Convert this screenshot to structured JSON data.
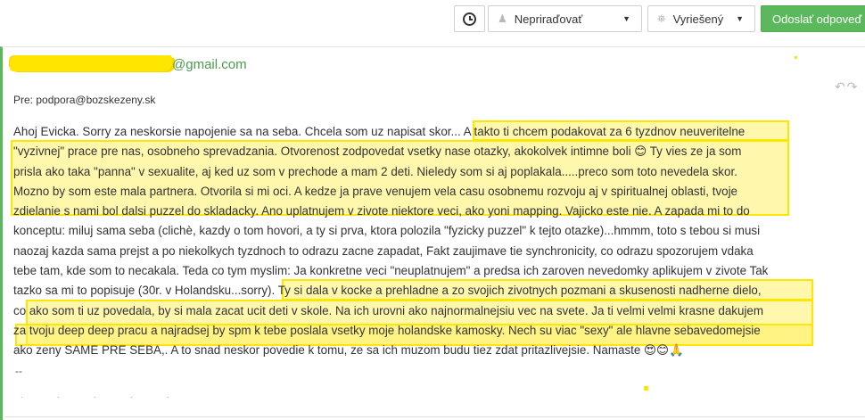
{
  "toolbar": {
    "clock_icon": "clock-icon",
    "assign_label": "Nepriraďovať",
    "status_label": "Vyriešený",
    "send_label": "Odoslať odpoveď"
  },
  "email": {
    "sender_email": "@gmail.com",
    "recipient": "Pre: podpora@bozskezeny.sk",
    "body_lines": [
      "Ahoj Evicka. Sorry za neskorsie napojenie sa na seba. Chcela som uz napisat skor... A takto ti chcem podakovat za 6 tyzdnov neuveritelne",
      "\"vyzivnej\" prace pre nas, osobneho sprevadzania. Otvorenost zodpovedat vsetky nase otazky, akokolvek intimne boli 😊 Ty vies ze ja som",
      "prisla ako taka \"panna\" v sexualite, aj ked uz som v prechode a mam 2 deti. Nieledy som si aj poplakala.....preco som toto nevedela skor.",
      "Mozno by som este mala partnera. Otvorila si mi oci. A kedze ja prave venujem vela casu osobnemu rozvoju aj v spiritualnej oblasti, tvoje",
      "zdielanie s nami bol dalsi puzzel do skladacky. Ano uplatnujem v zivote niektore veci, ako yoni mapping. Vajicko este nie. A zapada mi to do",
      "konceptu: miluj sama seba (clichè, kazdy o tom hovori, a ty si prva, ktora polozila \"fyzicky puzzel\" k tejto otazke)...hmmm, toto s tebou si musi",
      "naozaj kazda sama prejst a po niekolkych tyzdnoch to odrazu zacne zapadat, Fakt zaujimave tie synchronicity, co odrazu spozorujem vdaka",
      "tebe tam, kde som to necakala. Teda co tym myslim: Ja konkretne veci \"neuplatnujem\" a predsa ich zaroven nevedomky aplikujem v zivote Tak",
      "tazko sa mi to popisuje (30r. v Holandsku...sorry). Ty si dala v kocke a prehladne a zo svojich zivotnych pozmani a skusenosti nadherne dielo,",
      "co  ako som ti uz povedala, by si mala zacat ucit deti v skole. Na ich urovni ako najnormalnejsiu vec na svete. Ja ti velmi velmi krasne dakujem",
      "za tvoju deep deep pracu a najradsej by spm k tebe poslala vsetky moje holandske kamosky. Nech su viac \"sexy\" ale hlavne sebavedomejsie",
      "ako zeny SAME PRE SEBA,. A to snad neskor povedie k tomu, ze sa ich muzom budu tiez zdat pritazlivejsie. Namaste 😍😊🙏"
    ],
    "signature": "--"
  },
  "colors": {
    "accent_green": "#5cb85c",
    "highlight_yellow": "#ffe600"
  }
}
